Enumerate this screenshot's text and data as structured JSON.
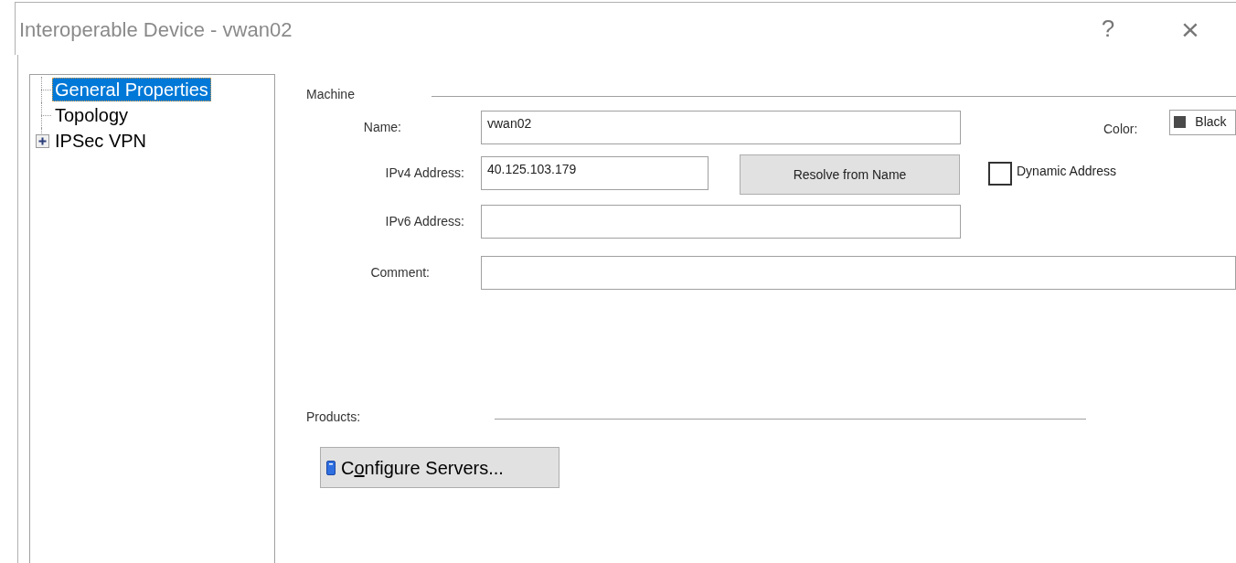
{
  "window": {
    "title": "Interoperable Device - vwan02",
    "help": "?",
    "close": "×"
  },
  "tree": {
    "items": [
      {
        "label": "General Properties",
        "selected": true
      },
      {
        "label": "Topology",
        "selected": false
      },
      {
        "label": "IPSec VPN",
        "selected": false,
        "expanded": false
      }
    ]
  },
  "machine": {
    "heading": "Machine",
    "name": {
      "label": "Name:",
      "value": "vwan02"
    },
    "color": {
      "label": "Color:",
      "value": "Black"
    },
    "ipv4": {
      "label": "IPv4 Address:",
      "value": "40.125.103.179"
    },
    "resolve_button": "Resolve from Name",
    "dynamic_address": {
      "label": "Dynamic Address",
      "checked": false
    },
    "ipv6": {
      "label": "IPv6 Address:"
    },
    "comment": {
      "label": "Comment:"
    }
  },
  "products": {
    "heading": "Products:",
    "button": {
      "label_before": "C",
      "access_key": "o",
      "label_after": "nfigure Servers..."
    }
  }
}
